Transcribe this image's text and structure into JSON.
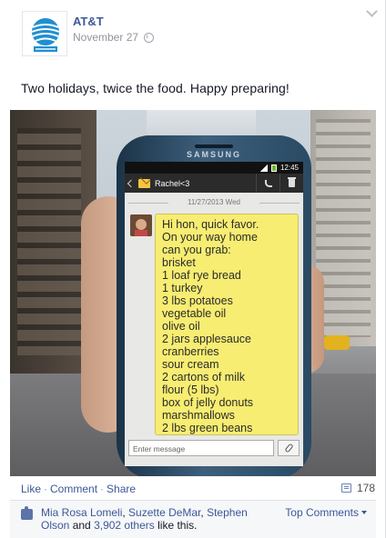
{
  "post": {
    "author": "AT&T",
    "date": "November 27",
    "caption": "Two holidays, twice the food. Happy preparing!"
  },
  "photo": {
    "phone": {
      "brand": "SAMSUNG",
      "time": "12:45",
      "contact": "Rachel<3",
      "date": "11/27/2013 Wed",
      "message_lines": [
        "Hi hon, quick favor.",
        "On your way home",
        "can you grab:",
        "brisket",
        "1 loaf rye bread",
        "1 turkey",
        "3 lbs potatoes",
        "vegetable oil",
        "olive oil",
        "2 jars applesauce",
        "cranberries",
        "sour cream",
        "2 cartons of milk",
        "flour (5 lbs)",
        "box of jelly donuts",
        "marshmallows",
        "2 lbs green beans"
      ],
      "input_placeholder": "Enter message"
    }
  },
  "actions": {
    "like": "Like",
    "comment": "Comment",
    "share": "Share",
    "separator": "·",
    "comment_count": "178"
  },
  "likes": {
    "names": [
      "Mia Rosa Lomeli",
      "Suzette DeMar",
      "Stephen Olson"
    ],
    "comma": ", ",
    "and_text": " and ",
    "others": "3,902 others",
    "suffix": " like this.",
    "top_comments": "Top Comments"
  },
  "icons": [
    "globe-icon",
    "chevron-down-icon",
    "att-logo",
    "signal-icon",
    "battery-icon",
    "back-arrow-icon",
    "envelope-icon",
    "call-icon",
    "trash-icon",
    "attach-icon",
    "comment-icon",
    "like-thumb-icon",
    "caret-down-icon"
  ],
  "colors": {
    "link": "#3b5998",
    "bubble": "#f7ed72",
    "att_blue": "#1f8fd1"
  }
}
